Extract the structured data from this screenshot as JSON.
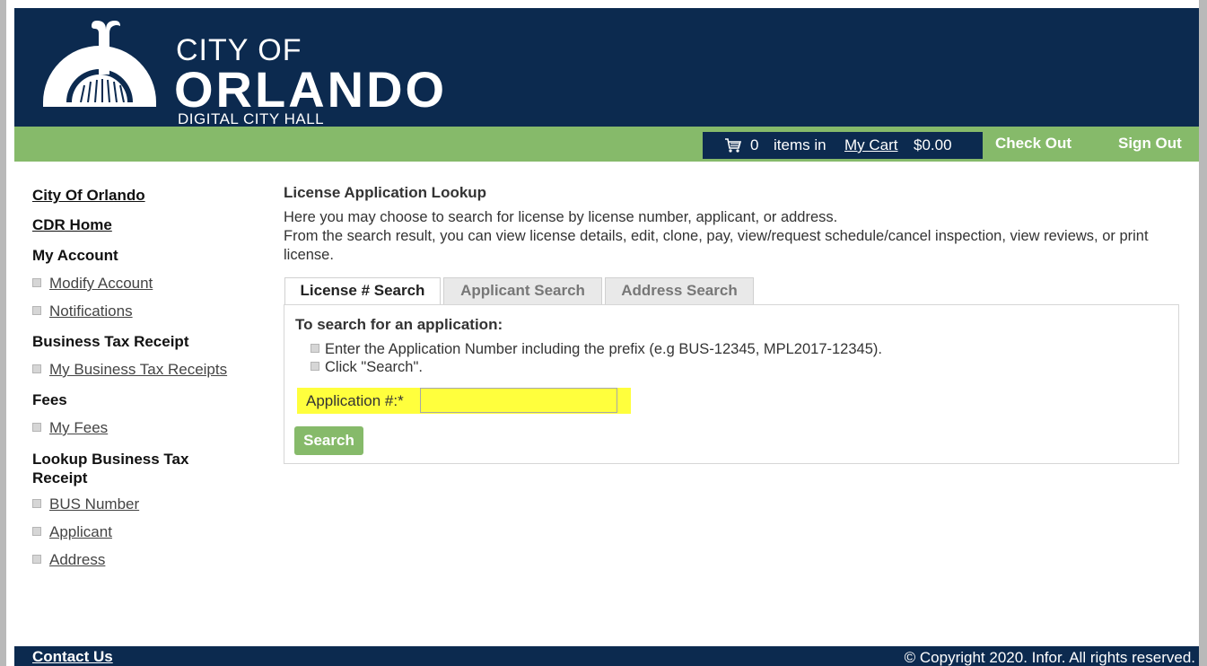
{
  "header": {
    "logo_line1": "CITY OF",
    "logo_line2": "ORLANDO",
    "logo_line3": "DIGITAL CITY HALL"
  },
  "cart": {
    "count": "0",
    "items_in": "items in",
    "my_cart": "My Cart",
    "total": "$0.00",
    "checkout": "Check Out",
    "signout": "Sign Out"
  },
  "sidebar": {
    "city_link": "City Of Orlando",
    "cdr_home": "CDR Home",
    "my_account": "My Account",
    "modify_account": "Modify Account",
    "notifications": "Notifications",
    "business_tax_receipt": "Business Tax Receipt",
    "my_business_tax_receipts": "My Business Tax Receipts",
    "fees": "Fees",
    "my_fees": "My Fees",
    "lookup_heading": "Lookup Business Tax Receipt",
    "bus_number": "BUS Number",
    "applicant": "Applicant",
    "address": "Address"
  },
  "main": {
    "title": "License Application Lookup",
    "desc_line1": "Here you may choose to search for license by license number, applicant, or address.",
    "desc_line2": "From the search result, you can view license details, edit, clone, pay, view/request schedule/cancel inspection, view reviews, or print license.",
    "tabs": [
      "License # Search",
      "Applicant Search",
      "Address Search"
    ],
    "panel_title": "To search for an application:",
    "instruction1": "Enter the Application Number including the prefix (e.g BUS-12345, MPL2017-12345).",
    "instruction2": "Click \"Search\".",
    "app_label": "Application #:*",
    "app_value": "",
    "search_button": "Search"
  },
  "footer": {
    "contact": "Contact Us",
    "copyright": "© Copyright 2020. Infor. All rights reserved."
  },
  "colors": {
    "navy": "#0c2a4f",
    "green": "#86ba6a",
    "highlight": "#ffff3d"
  }
}
